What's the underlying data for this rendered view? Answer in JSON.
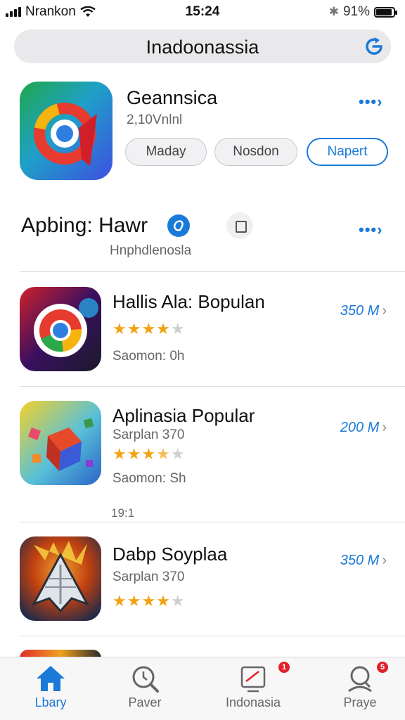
{
  "status": {
    "carrier": "Nrankon",
    "time": "15:24",
    "battery": "91%",
    "battery_level": 0.91
  },
  "search": {
    "query": "Inadoonassia"
  },
  "featured": {
    "title": "Geannsica",
    "subtitle": "2,10Vnlnl",
    "buttons": [
      "Maday",
      "Nosdon",
      "Napert"
    ]
  },
  "section": {
    "title": "Apbing: Hawr",
    "subtitle": "Hnphdlenosla"
  },
  "apps": [
    {
      "title": "Hallis Ala: Bopulan",
      "subtitle": "Saomon: 0h",
      "rating": 4,
      "size": "350 M"
    },
    {
      "title": "Aplinasia Popular",
      "subtitle": "Sarplan 370",
      "rating": 3.5,
      "meta": "Saomon: Sh",
      "size": "200 M"
    },
    {
      "title": "Dabp Soyplaa",
      "subtitle": "Sarplan 370",
      "rating": 4,
      "size": "350 M"
    }
  ],
  "list_label": "19:1",
  "tabs": [
    {
      "label": "Lbary",
      "icon": "home-icon",
      "active": true
    },
    {
      "label": "Paver",
      "icon": "magnifier-icon"
    },
    {
      "label": "Indonasia",
      "icon": "tablet-icon",
      "badge": "1"
    },
    {
      "label": "Praye",
      "icon": "person-search-icon",
      "badge": "5"
    }
  ],
  "colors": {
    "accent": "#1a7ad8",
    "star": "#f2a312",
    "badge": "#e0202a"
  }
}
